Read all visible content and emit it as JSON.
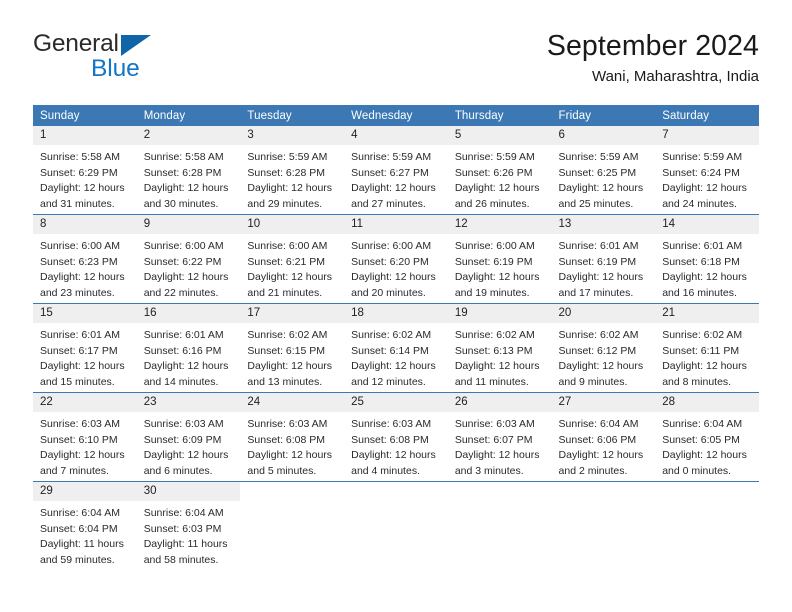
{
  "brand": {
    "name_part1": "General",
    "name_part2": "Blue",
    "accent_color": "#1476c4",
    "triangle_color": "#1065a8"
  },
  "header": {
    "title": "September 2024",
    "location": "Wani, Maharashtra, India"
  },
  "theme": {
    "header_row_bg": "#3b78b4",
    "daynum_bg": "#efefef",
    "grid_line": "#3b78b4"
  },
  "weekdays": [
    "Sunday",
    "Monday",
    "Tuesday",
    "Wednesday",
    "Thursday",
    "Friday",
    "Saturday"
  ],
  "weeks": [
    [
      {
        "day": "1",
        "sunrise": "Sunrise: 5:58 AM",
        "sunset": "Sunset: 6:29 PM",
        "daylight1": "Daylight: 12 hours",
        "daylight2": "and 31 minutes."
      },
      {
        "day": "2",
        "sunrise": "Sunrise: 5:58 AM",
        "sunset": "Sunset: 6:28 PM",
        "daylight1": "Daylight: 12 hours",
        "daylight2": "and 30 minutes."
      },
      {
        "day": "3",
        "sunrise": "Sunrise: 5:59 AM",
        "sunset": "Sunset: 6:28 PM",
        "daylight1": "Daylight: 12 hours",
        "daylight2": "and 29 minutes."
      },
      {
        "day": "4",
        "sunrise": "Sunrise: 5:59 AM",
        "sunset": "Sunset: 6:27 PM",
        "daylight1": "Daylight: 12 hours",
        "daylight2": "and 27 minutes."
      },
      {
        "day": "5",
        "sunrise": "Sunrise: 5:59 AM",
        "sunset": "Sunset: 6:26 PM",
        "daylight1": "Daylight: 12 hours",
        "daylight2": "and 26 minutes."
      },
      {
        "day": "6",
        "sunrise": "Sunrise: 5:59 AM",
        "sunset": "Sunset: 6:25 PM",
        "daylight1": "Daylight: 12 hours",
        "daylight2": "and 25 minutes."
      },
      {
        "day": "7",
        "sunrise": "Sunrise: 5:59 AM",
        "sunset": "Sunset: 6:24 PM",
        "daylight1": "Daylight: 12 hours",
        "daylight2": "and 24 minutes."
      }
    ],
    [
      {
        "day": "8",
        "sunrise": "Sunrise: 6:00 AM",
        "sunset": "Sunset: 6:23 PM",
        "daylight1": "Daylight: 12 hours",
        "daylight2": "and 23 minutes."
      },
      {
        "day": "9",
        "sunrise": "Sunrise: 6:00 AM",
        "sunset": "Sunset: 6:22 PM",
        "daylight1": "Daylight: 12 hours",
        "daylight2": "and 22 minutes."
      },
      {
        "day": "10",
        "sunrise": "Sunrise: 6:00 AM",
        "sunset": "Sunset: 6:21 PM",
        "daylight1": "Daylight: 12 hours",
        "daylight2": "and 21 minutes."
      },
      {
        "day": "11",
        "sunrise": "Sunrise: 6:00 AM",
        "sunset": "Sunset: 6:20 PM",
        "daylight1": "Daylight: 12 hours",
        "daylight2": "and 20 minutes."
      },
      {
        "day": "12",
        "sunrise": "Sunrise: 6:00 AM",
        "sunset": "Sunset: 6:19 PM",
        "daylight1": "Daylight: 12 hours",
        "daylight2": "and 19 minutes."
      },
      {
        "day": "13",
        "sunrise": "Sunrise: 6:01 AM",
        "sunset": "Sunset: 6:19 PM",
        "daylight1": "Daylight: 12 hours",
        "daylight2": "and 17 minutes."
      },
      {
        "day": "14",
        "sunrise": "Sunrise: 6:01 AM",
        "sunset": "Sunset: 6:18 PM",
        "daylight1": "Daylight: 12 hours",
        "daylight2": "and 16 minutes."
      }
    ],
    [
      {
        "day": "15",
        "sunrise": "Sunrise: 6:01 AM",
        "sunset": "Sunset: 6:17 PM",
        "daylight1": "Daylight: 12 hours",
        "daylight2": "and 15 minutes."
      },
      {
        "day": "16",
        "sunrise": "Sunrise: 6:01 AM",
        "sunset": "Sunset: 6:16 PM",
        "daylight1": "Daylight: 12 hours",
        "daylight2": "and 14 minutes."
      },
      {
        "day": "17",
        "sunrise": "Sunrise: 6:02 AM",
        "sunset": "Sunset: 6:15 PM",
        "daylight1": "Daylight: 12 hours",
        "daylight2": "and 13 minutes."
      },
      {
        "day": "18",
        "sunrise": "Sunrise: 6:02 AM",
        "sunset": "Sunset: 6:14 PM",
        "daylight1": "Daylight: 12 hours",
        "daylight2": "and 12 minutes."
      },
      {
        "day": "19",
        "sunrise": "Sunrise: 6:02 AM",
        "sunset": "Sunset: 6:13 PM",
        "daylight1": "Daylight: 12 hours",
        "daylight2": "and 11 minutes."
      },
      {
        "day": "20",
        "sunrise": "Sunrise: 6:02 AM",
        "sunset": "Sunset: 6:12 PM",
        "daylight1": "Daylight: 12 hours",
        "daylight2": "and 9 minutes."
      },
      {
        "day": "21",
        "sunrise": "Sunrise: 6:02 AM",
        "sunset": "Sunset: 6:11 PM",
        "daylight1": "Daylight: 12 hours",
        "daylight2": "and 8 minutes."
      }
    ],
    [
      {
        "day": "22",
        "sunrise": "Sunrise: 6:03 AM",
        "sunset": "Sunset: 6:10 PM",
        "daylight1": "Daylight: 12 hours",
        "daylight2": "and 7 minutes."
      },
      {
        "day": "23",
        "sunrise": "Sunrise: 6:03 AM",
        "sunset": "Sunset: 6:09 PM",
        "daylight1": "Daylight: 12 hours",
        "daylight2": "and 6 minutes."
      },
      {
        "day": "24",
        "sunrise": "Sunrise: 6:03 AM",
        "sunset": "Sunset: 6:08 PM",
        "daylight1": "Daylight: 12 hours",
        "daylight2": "and 5 minutes."
      },
      {
        "day": "25",
        "sunrise": "Sunrise: 6:03 AM",
        "sunset": "Sunset: 6:08 PM",
        "daylight1": "Daylight: 12 hours",
        "daylight2": "and 4 minutes."
      },
      {
        "day": "26",
        "sunrise": "Sunrise: 6:03 AM",
        "sunset": "Sunset: 6:07 PM",
        "daylight1": "Daylight: 12 hours",
        "daylight2": "and 3 minutes."
      },
      {
        "day": "27",
        "sunrise": "Sunrise: 6:04 AM",
        "sunset": "Sunset: 6:06 PM",
        "daylight1": "Daylight: 12 hours",
        "daylight2": "and 2 minutes."
      },
      {
        "day": "28",
        "sunrise": "Sunrise: 6:04 AM",
        "sunset": "Sunset: 6:05 PM",
        "daylight1": "Daylight: 12 hours",
        "daylight2": "and 0 minutes."
      }
    ],
    [
      {
        "day": "29",
        "sunrise": "Sunrise: 6:04 AM",
        "sunset": "Sunset: 6:04 PM",
        "daylight1": "Daylight: 11 hours",
        "daylight2": "and 59 minutes."
      },
      {
        "day": "30",
        "sunrise": "Sunrise: 6:04 AM",
        "sunset": "Sunset: 6:03 PM",
        "daylight1": "Daylight: 11 hours",
        "daylight2": "and 58 minutes."
      },
      {
        "day": "",
        "sunrise": "",
        "sunset": "",
        "daylight1": "",
        "daylight2": ""
      },
      {
        "day": "",
        "sunrise": "",
        "sunset": "",
        "daylight1": "",
        "daylight2": ""
      },
      {
        "day": "",
        "sunrise": "",
        "sunset": "",
        "daylight1": "",
        "daylight2": ""
      },
      {
        "day": "",
        "sunrise": "",
        "sunset": "",
        "daylight1": "",
        "daylight2": ""
      },
      {
        "day": "",
        "sunrise": "",
        "sunset": "",
        "daylight1": "",
        "daylight2": ""
      }
    ]
  ]
}
